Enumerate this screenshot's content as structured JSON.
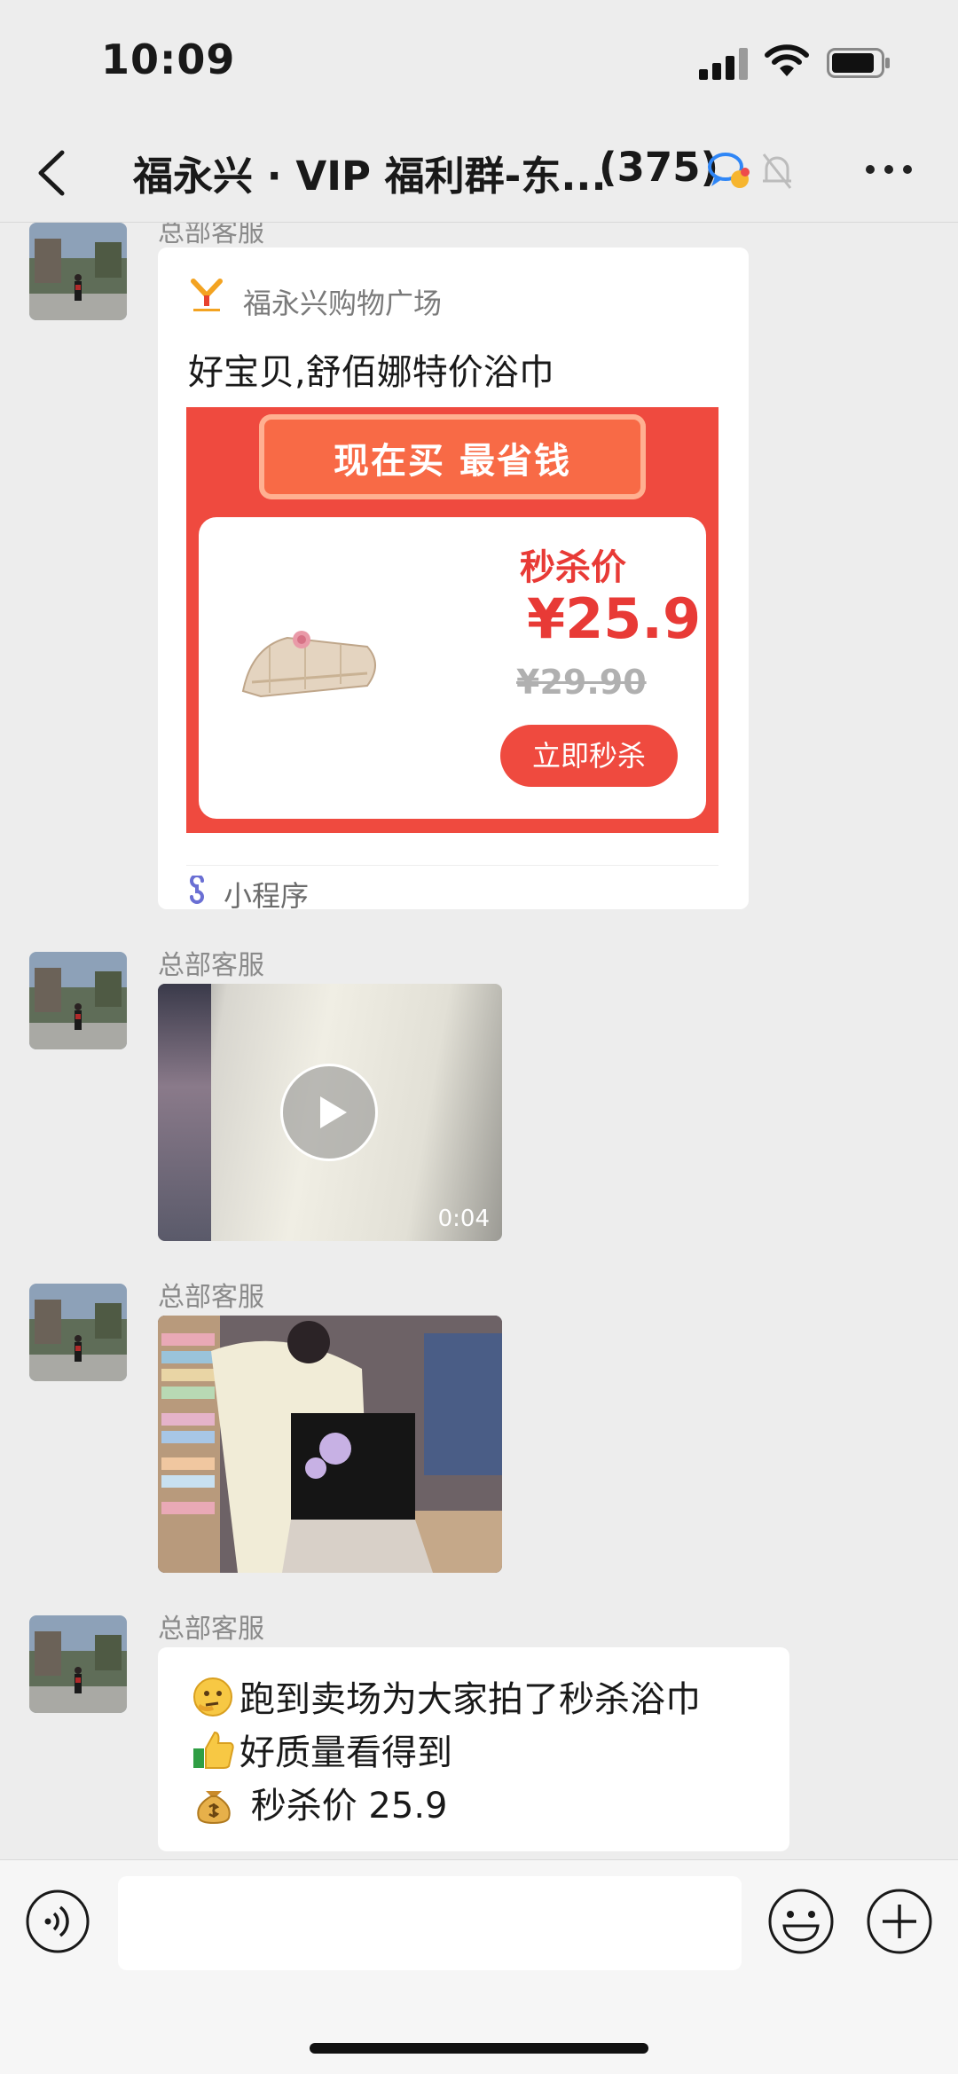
{
  "status_bar": {
    "time": "10:09"
  },
  "nav": {
    "title": "福永兴 · VIP 福利群-东...",
    "member_count": "(375)"
  },
  "messages": [
    {
      "type": "mini_program_card",
      "sender": "总部客服",
      "source": "福永兴购物广场",
      "title": "好宝贝,舒佰娜特价浴巾",
      "banner": "现在买 最省钱",
      "seckill_label": "秒杀价",
      "price": "¥25.9",
      "original_price": "¥29.90",
      "buy_button": "立即秒杀",
      "footer_label": "小程序"
    },
    {
      "type": "video",
      "sender": "总部客服",
      "duration": "0:04"
    },
    {
      "type": "image",
      "sender": "总部客服"
    },
    {
      "type": "text",
      "sender": "总部客服",
      "lines": [
        {
          "emoji": "thinking-face",
          "text": "跑到卖场为大家拍了秒杀浴巾"
        },
        {
          "emoji": "thumbs-up",
          "text": "好质量看得到"
        },
        {
          "emoji": "money-bag",
          "text": " 秒杀价 25.9"
        }
      ]
    }
  ],
  "input_bar": {
    "placeholder": ""
  },
  "colors": {
    "accent_red": "#e83a36",
    "chat_bg": "#ededed",
    "bubble_bg": "#ffffff",
    "mini_program_icon": "#6a6fd4"
  }
}
